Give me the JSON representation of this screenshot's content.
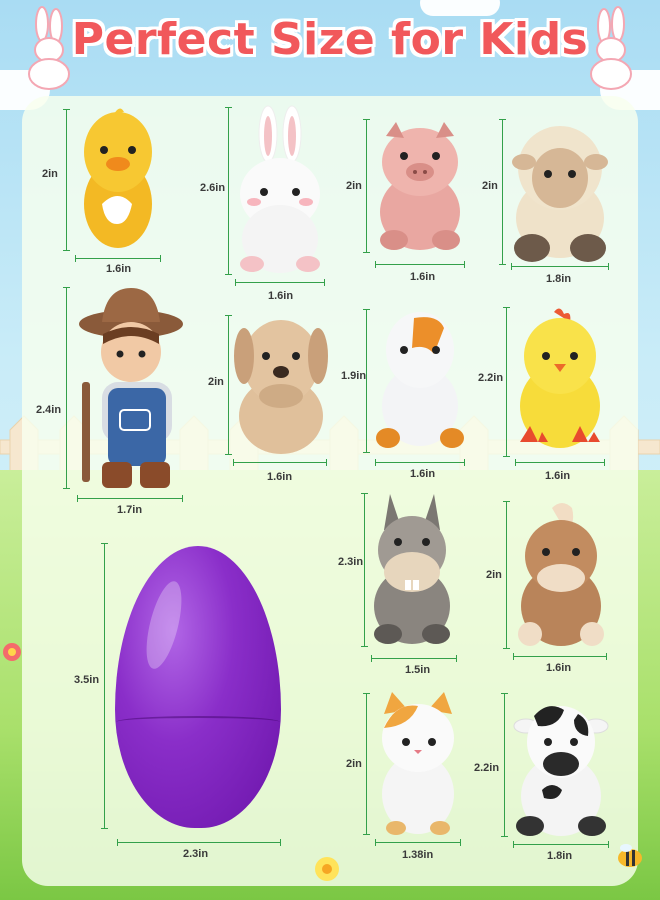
{
  "title": "Perfect Size for Kids",
  "colors": {
    "title": "#f1585b",
    "dimension_line": "#33a04a",
    "egg": "#7a1fbf"
  },
  "figures": [
    {
      "name": "duck",
      "height": "2in",
      "width": "1.6in"
    },
    {
      "name": "bunny",
      "height": "2.6in",
      "width": "1.6in"
    },
    {
      "name": "pig",
      "height": "2in",
      "width": "1.6in"
    },
    {
      "name": "sheep",
      "height": "2in",
      "width": "1.8in"
    },
    {
      "name": "farmer",
      "height": "2.4in",
      "width": "1.7in"
    },
    {
      "name": "dog",
      "height": "2in",
      "width": "1.6in"
    },
    {
      "name": "goose",
      "height": "1.9in",
      "width": "1.6in"
    },
    {
      "name": "chick",
      "height": "2.2in",
      "width": "1.6in"
    },
    {
      "name": "donkey",
      "height": "2.3in",
      "width": "1.5in"
    },
    {
      "name": "horse",
      "height": "2in",
      "width": "1.6in"
    },
    {
      "name": "egg",
      "height": "3.5in",
      "width": "2.3in"
    },
    {
      "name": "cat",
      "height": "2in",
      "width": "1.38in"
    },
    {
      "name": "cow",
      "height": "2.2in",
      "width": "1.8in"
    }
  ]
}
